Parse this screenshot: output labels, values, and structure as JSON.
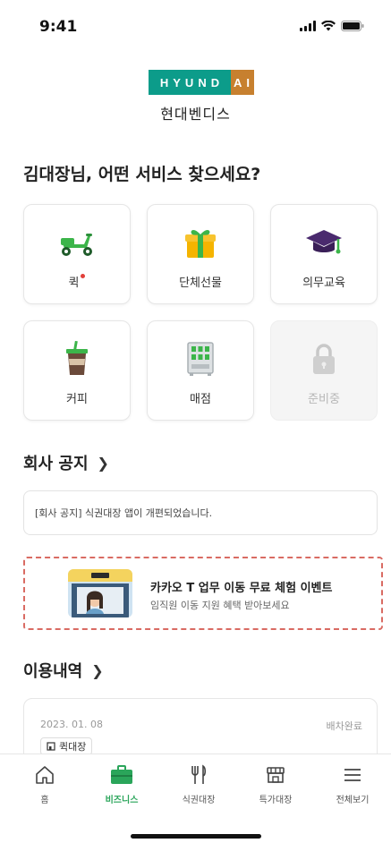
{
  "status_bar": {
    "time": "9:41"
  },
  "logo": {
    "brand_left": "HYUND",
    "brand_right": "AI",
    "subtitle": "현대벤디스"
  },
  "greeting": "김대장님, 어떤 서비스 찾으세요?",
  "services": [
    {
      "label": "퀵",
      "icon": "scooter-icon",
      "new_dot": true
    },
    {
      "label": "단체선물",
      "icon": "gift-icon"
    },
    {
      "label": "의무교육",
      "icon": "graduation-cap-icon"
    },
    {
      "label": "커피",
      "icon": "coffee-cup-icon"
    },
    {
      "label": "매점",
      "icon": "vending-machine-icon"
    },
    {
      "label": "준비중",
      "icon": "lock-icon",
      "disabled": true
    }
  ],
  "notice_section": {
    "title": "회사 공지",
    "item": "[회사 공지] 식권대장 앱이 개편되었습니다."
  },
  "banner": {
    "title": "카카오 T 업무 이동 무료 체험 이벤트",
    "subtitle": "임직원 이동 지원 혜택 받아보세요"
  },
  "history_section": {
    "title": "이용내역",
    "items": [
      {
        "date": "2023. 01. 08",
        "status": "배차완료",
        "tag": "퀵대장"
      }
    ]
  },
  "tabs": [
    {
      "label": "홈",
      "icon": "home-icon"
    },
    {
      "label": "비즈니스",
      "icon": "briefcase-icon",
      "active": true
    },
    {
      "label": "식권대장",
      "icon": "utensils-icon"
    },
    {
      "label": "특가대장",
      "icon": "store-icon"
    },
    {
      "label": "전체보기",
      "icon": "menu-icon"
    }
  ],
  "colors": {
    "accent_green": "#2aa55a",
    "logo_teal": "#0c9c8a",
    "logo_gold": "#c7802f",
    "banner_border": "#d96b63",
    "new_dot": "#e2403a"
  }
}
